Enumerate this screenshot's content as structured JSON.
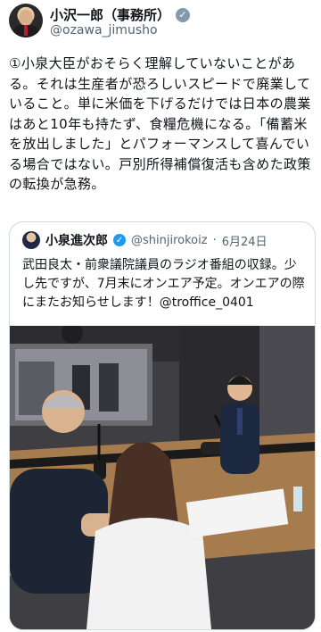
{
  "author": {
    "display_name": "小沢一郎（事務所）",
    "handle": "@ozawa_jimusho",
    "verified_icon": "verified-badge-gray"
  },
  "tweet": {
    "text": "①小泉大臣がおそらく理解していないことがある。それは生産者が恐ろしいスピードで廃業していること。単に米価を下げるだけでは日本の農業はあと10年も持たず、食糧危機になる。「備蓄米を放出しました」とパフォーマンスして喜んでいる場合ではない。戸別所得補償復活も含めた政策の転換が急務。"
  },
  "quoted": {
    "display_name": "小泉進次郎",
    "handle": "@shinjirokoiz",
    "separator": "·",
    "date": "6月24日",
    "text": "武田良太・前衆議院議員のラジオ番組の収録。少し先ですが、7月末にオンエア予定。オンエアの際にまたお知らせします！@troffice_0401",
    "verified_icon": "verified-badge-blue"
  }
}
